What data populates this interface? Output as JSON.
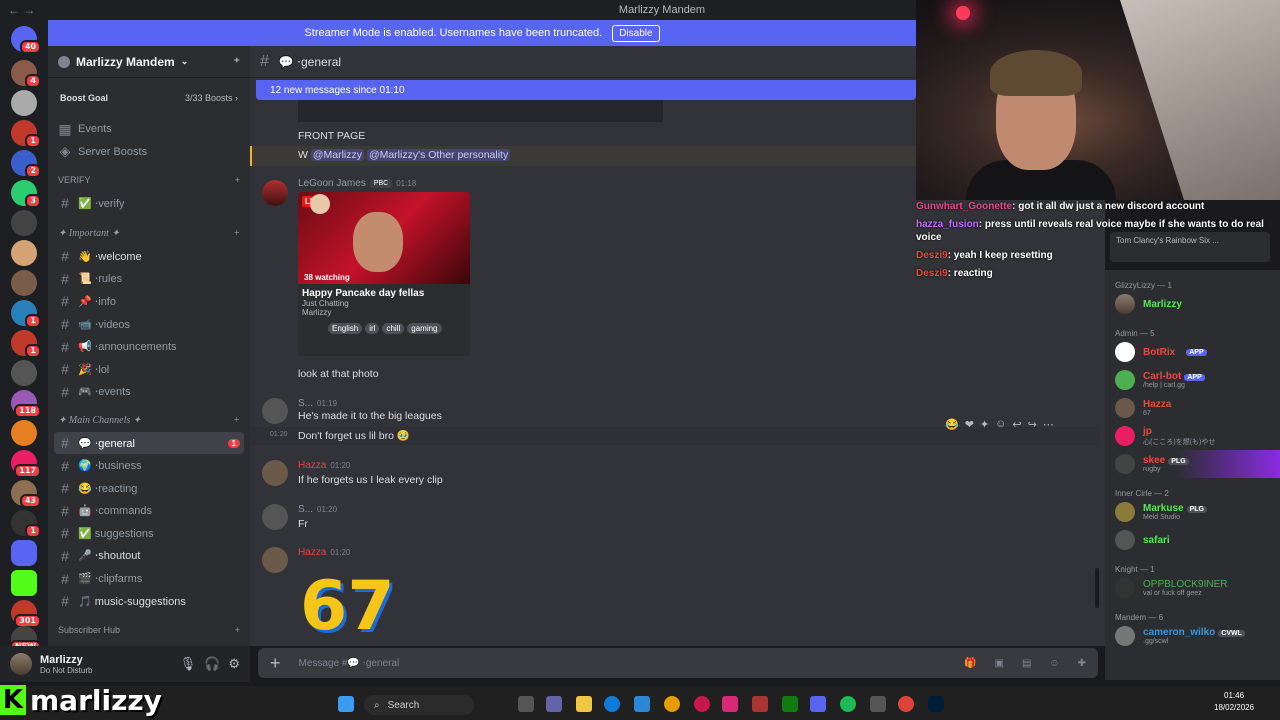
{
  "window": {
    "title": "Marlizzy Mandem"
  },
  "banner": {
    "text": "Streamer Mode is enabled. Usernames have been truncated.",
    "button": "Disable"
  },
  "servers": {
    "badges": [
      "40",
      "4",
      "",
      "1",
      "",
      "2",
      "3",
      "",
      "",
      "",
      "1",
      "1",
      "",
      "",
      "118",
      "",
      "117",
      "43",
      "1",
      "",
      "",
      "",
      "301",
      "NEW"
    ]
  },
  "guild": {
    "name": "Marlizzy Mandem",
    "boost_goal": "Boost Goal",
    "boost_count": "3/33 Boosts"
  },
  "sidebar": {
    "top_items": [
      "Events",
      "Server Boosts"
    ],
    "cat_verify": "VERIFY",
    "verify": "✅ ⋅verify",
    "cat_important": "✦ Important ✦",
    "important": [
      "👋 ⋅welcome",
      "📜 ⋅rules",
      "📌 ⋅info",
      "📹 ⋅videos",
      "📢 ⋅announcements",
      "🎉 ⋅lol",
      "🎮 ⋅events"
    ],
    "cat_main": "✦ Main Channels ✦",
    "main": [
      "💬 ⋅general",
      "🌍 ⋅business",
      "😂 ⋅reacting",
      "🤖 ⋅commands",
      "✅ suggestions",
      "🎤 ⋅shoutout",
      "🎬 ⋅clipfarms",
      "🎵 music-suggestions"
    ],
    "general_badge": "1",
    "cat_sub": "Subscriber Hub"
  },
  "user": {
    "name": "Marlizzy",
    "status": "Do Not Disturb"
  },
  "chat": {
    "channel": "💬 ⋅general",
    "new_messages": "12 new messages since 01:10",
    "m0_title": "FRONT PAGE",
    "m0_text_w": "W",
    "m0_mention1": "@Marlizzy",
    "m0_mention2": "@Marlizzy's Other personality",
    "m1_name": "LeGoon James",
    "m1_tag": "PBC",
    "m1_time": "01:18",
    "stream": {
      "live": "LIVE",
      "watching": "38 watching",
      "title": "Happy Pancake day fellas",
      "category": "Just Chatting",
      "streamer": "Marlizzy",
      "tags": [
        "English",
        "irl",
        "chill",
        "gaming"
      ]
    },
    "m1_text": "look at that photo",
    "m2_name": "S...",
    "m2_time": "01:19",
    "m2_text": "He's made it to the big leagues",
    "m2b_time": "01:20",
    "m2b_text": "Don't forget us lil bro 🥹",
    "m3_name": "Hazza",
    "m3_time": "01:20",
    "m3_text": "If he forgets us I leak every clip",
    "m4_name": "S...",
    "m4_time": "01:20",
    "m4_text": "Fr",
    "m5_name": "Hazza",
    "m5_time": "01:20",
    "m5_big": "67",
    "input_placeholder": "Message #💬 ⋅general"
  },
  "members": {
    "groups": [
      {
        "title": "GlizzyLizzy — 1",
        "items": [
          {
            "name": "Marlizzy",
            "color": "#5be35b",
            "sub": ""
          }
        ]
      },
      {
        "title": "Admin — 5",
        "items": [
          {
            "name": "BotRix",
            "color": "#e74c3c",
            "sub": "",
            "app": "APP"
          },
          {
            "name": "Carl-bot",
            "color": "#e74c3c",
            "sub": "/help | carl.gg",
            "app": "APP"
          },
          {
            "name": "Hazza",
            "color": "#e74c3c",
            "sub": "67"
          },
          {
            "name": "jp",
            "color": "#e74c3c",
            "sub": "心(こころ)を燃(も)やせ"
          },
          {
            "name": "skee",
            "color": "#e74c3c",
            "sub": "rugby",
            "app": "PLG"
          }
        ]
      },
      {
        "title": "Inner Cirle — 2",
        "items": [
          {
            "name": "Markuse",
            "color": "#5be35b",
            "sub": "Meld Studio",
            "app": "PLG"
          },
          {
            "name": "safari",
            "color": "#5be35b",
            "sub": ""
          }
        ]
      },
      {
        "title": "Knight — 1",
        "items": [
          {
            "name": "OPPBLOCK9INER",
            "color": "#4caf50",
            "sub": "val or fuck off geez"
          }
        ]
      },
      {
        "title": "Mandem — 6",
        "items": [
          {
            "name": "cameron_wilko",
            "color": "#3498db",
            "sub": ".gg/scwl",
            "app": "CVWL"
          }
        ]
      }
    ]
  },
  "overlay_chat": [
    {
      "user": "Gunwhart_Goonette",
      "color": "#e24a8c",
      "text": ": got it all dw just a new discord account"
    },
    {
      "user": "hazza_fusion",
      "color": "#c36bff",
      "text": ": press until reveals real voice maybe if she wants to do real voice"
    },
    {
      "user": "Deszi9",
      "color": "#e74c3c",
      "text": ": yeah I keep resetting"
    },
    {
      "user": "Deszi9",
      "color": "#e74c3c",
      "text": ": reacting"
    }
  ],
  "overlay_activity": "Tom Clancy's Rainbow Six ...",
  "brand": {
    "letter": "K",
    "word": "marlizzy"
  },
  "taskbar": {
    "search": "Search",
    "time": "01:46",
    "date": "18/02/2026"
  }
}
